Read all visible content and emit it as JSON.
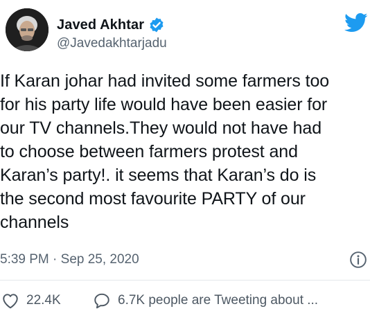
{
  "tweet": {
    "author": {
      "display_name": "Javed Akhtar",
      "handle": "@Javedakhtarjadu",
      "verified": true
    },
    "text": "If Karan johar had invited some farmers too\nfor his party life would have been easier for\nour TV channels.They would not have had\nto choose between farmers protest and\nKaran’s party!. it seems that Karan’s do is\nthe second most favourite PARTY of  our\nchannels",
    "timestamp": "5:39 PM · Sep 25, 2020",
    "likes": "22.4K",
    "tweeting_about": "6.7K people are Tweeting about ..."
  },
  "icons": {
    "logo": "twitter-bird-icon",
    "verified": "verified-badge-icon",
    "info": "info-icon",
    "like": "heart-icon",
    "reply": "speech-bubble-icon"
  },
  "colors": {
    "brand": "#1d9bf0",
    "text": "#0f1419",
    "secondary_text": "#566370",
    "divider": "#e3e7ea"
  }
}
